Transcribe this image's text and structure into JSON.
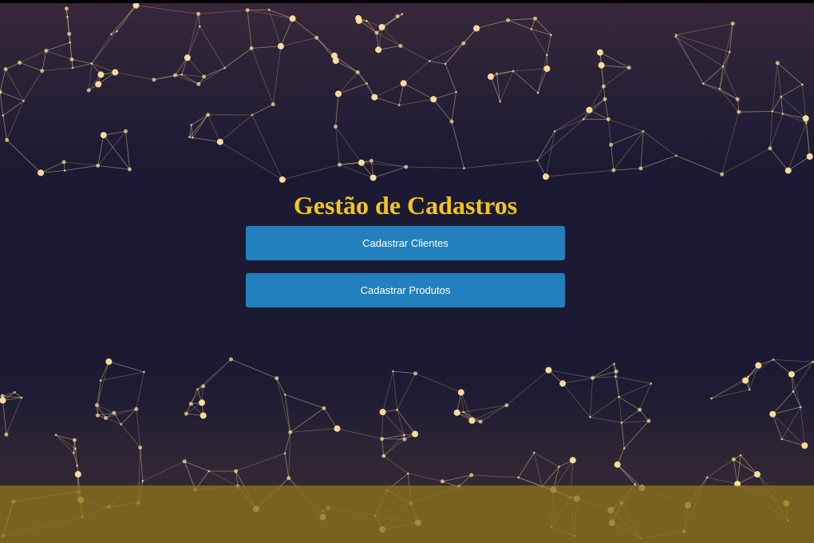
{
  "page": {
    "title": "Gestão de Cadastros"
  },
  "buttons": {
    "clientes_label": "Cadastrar Clientes",
    "produtos_label": "Cadastrar Produtos"
  },
  "colors": {
    "background": "#1b1a32",
    "title": "#f5c518",
    "button": "#2280be",
    "footer_band": "#8c7319",
    "network_node": "#ffe6a0"
  }
}
